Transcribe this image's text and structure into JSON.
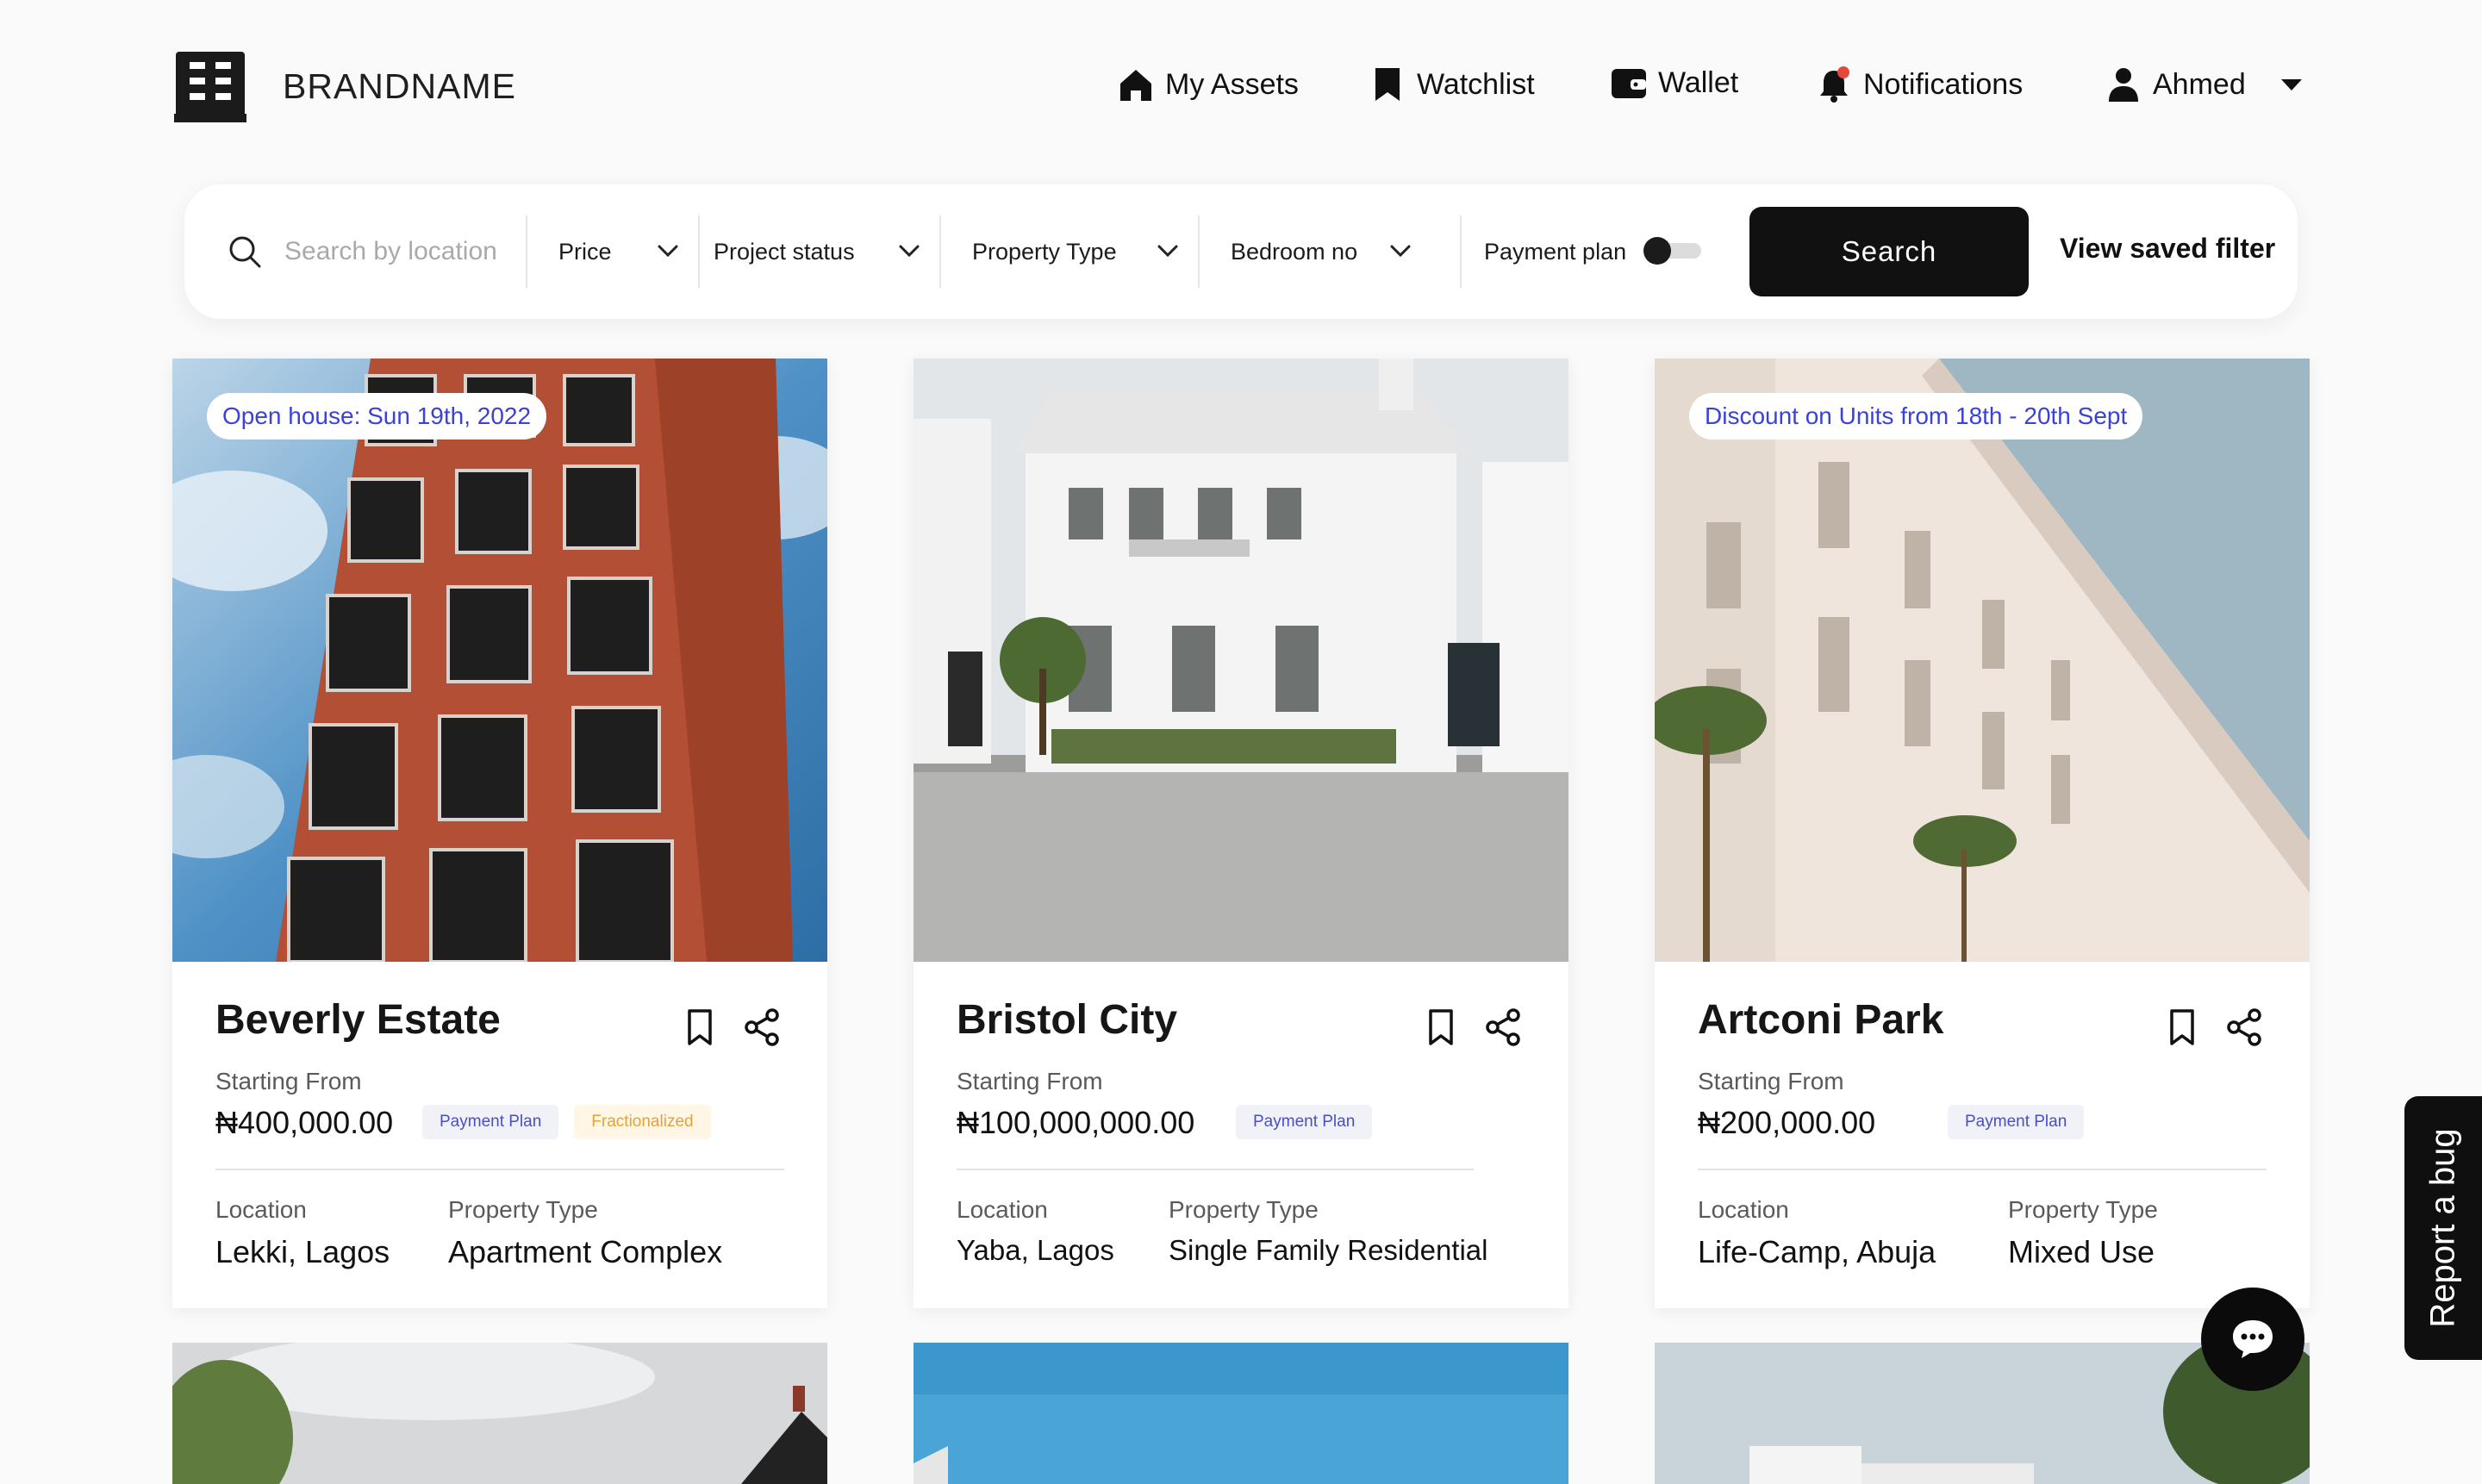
{
  "brand": {
    "name": "BRANDNAME",
    "logo_icon": "building-icon"
  },
  "nav": {
    "my_assets": "My Assets",
    "watchlist": "Watchlist",
    "wallet": "Wallet",
    "notifications": "Notifications",
    "user": "Ahmed"
  },
  "search": {
    "placeholder": "Search by location",
    "price": "Price",
    "project_status": "Project status",
    "property_type": "Property Type",
    "bedroom_no": "Bedroom no",
    "payment_plan": "Payment plan",
    "payment_plan_on": false,
    "button": "Search",
    "saved_filter": "View saved filter"
  },
  "cards": [
    {
      "promo": "Open house: Sun 19th, 2022",
      "title": "Beverly Estate",
      "starting_label": "Starting From",
      "price": "₦400,000.00",
      "badges": [
        "Payment Plan",
        "Fractionalized"
      ],
      "location_label": "Location",
      "location": "Lekki, Lagos",
      "type_label": "Property Type",
      "type": "Apartment Complex"
    },
    {
      "promo": "",
      "title": "Bristol City",
      "starting_label": "Starting From",
      "price": "₦100,000,000.00",
      "badges": [
        "Payment Plan"
      ],
      "location_label": "Location",
      "location": "Yaba, Lagos",
      "type_label": "Property Type",
      "type": "Single Family Residential"
    },
    {
      "promo": "Discount on Units from 18th - 20th Sept",
      "title": "Artconi Park",
      "starting_label": "Starting From",
      "price": "₦200,000.00",
      "badges": [
        "Payment Plan"
      ],
      "location_label": "Location",
      "location": "Life-Camp, Abuja",
      "type_label": "Property Type",
      "type": "Mixed Use"
    }
  ],
  "floating": {
    "report_bug": "Report a bug",
    "chat_icon": "chat-bubble-icon"
  },
  "colors": {
    "accent": "#3b42d6",
    "dark": "#111111",
    "badge_orange": "#e3a23a",
    "notification_dot": "#e4483a"
  }
}
